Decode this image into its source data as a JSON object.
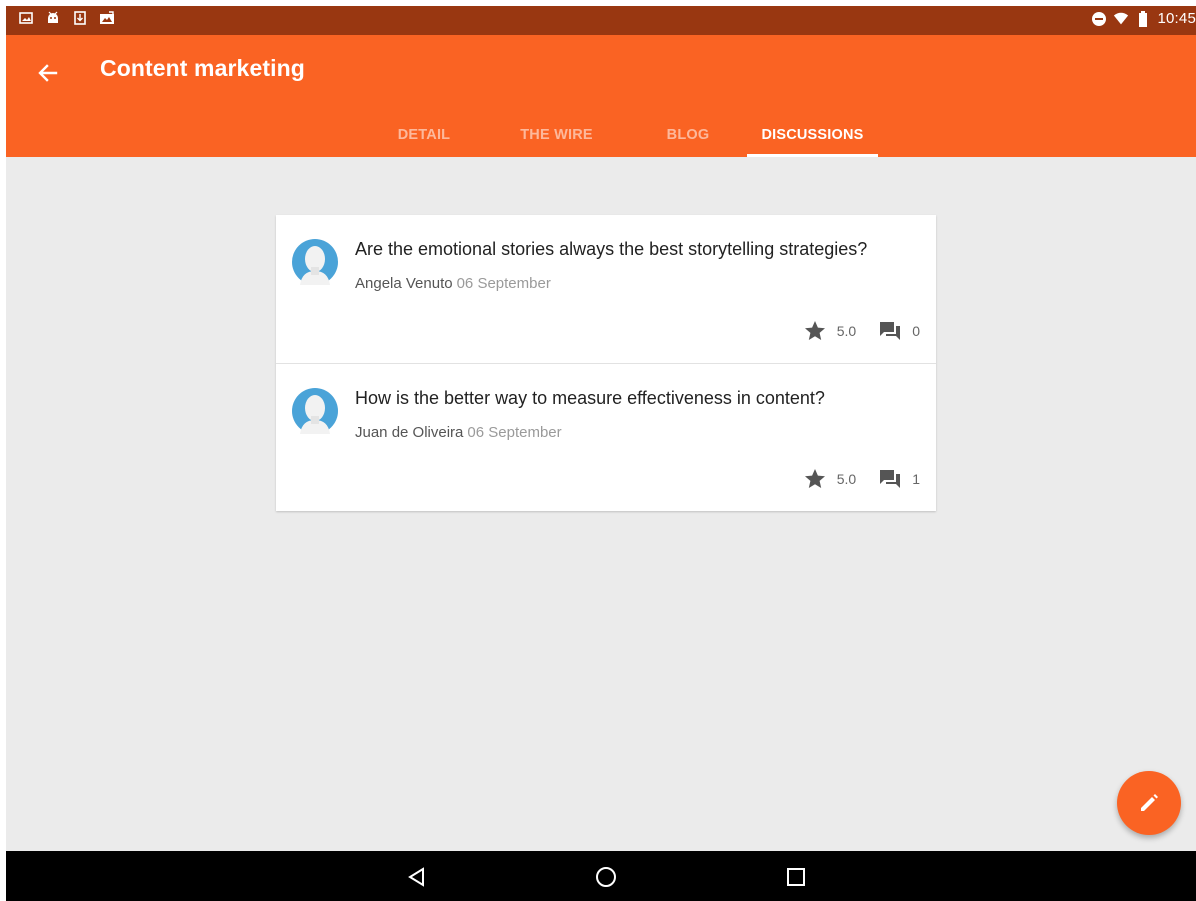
{
  "status_bar": {
    "time": "10:45",
    "left_icons": [
      "image-icon",
      "android-icon",
      "download-icon",
      "photo-update-icon"
    ],
    "right_icons": [
      "do-not-disturb-icon",
      "wifi-icon",
      "battery-icon"
    ]
  },
  "app_bar": {
    "title": "Content marketing",
    "back_icon": "arrow-back-icon",
    "color": "#fa6323"
  },
  "tabs": [
    {
      "label": "DETAIL",
      "active": false
    },
    {
      "label": "THE WIRE",
      "active": false
    },
    {
      "label": "BLOG",
      "active": false
    },
    {
      "label": "DISCUSSIONS",
      "active": true
    }
  ],
  "discussions": [
    {
      "title": "Are the emotional stories always the best storytelling strategies?",
      "author": "Angela Venuto",
      "date": "06 September",
      "rating": "5.0",
      "comments": "0"
    },
    {
      "title": "How is the better way to measure effectiveness in content?",
      "author": "Juan de Oliveira",
      "date": "06 September",
      "rating": "5.0",
      "comments": "1"
    }
  ],
  "fab": {
    "icon": "edit-pencil-icon"
  },
  "nav_bar": {
    "icons": [
      "back-triangle-icon",
      "home-circle-icon",
      "recents-square-icon"
    ]
  },
  "colors": {
    "accent": "#fa6323",
    "status_bar": "#993711",
    "background": "#ebebeb",
    "avatar": "#4aa3d8"
  }
}
